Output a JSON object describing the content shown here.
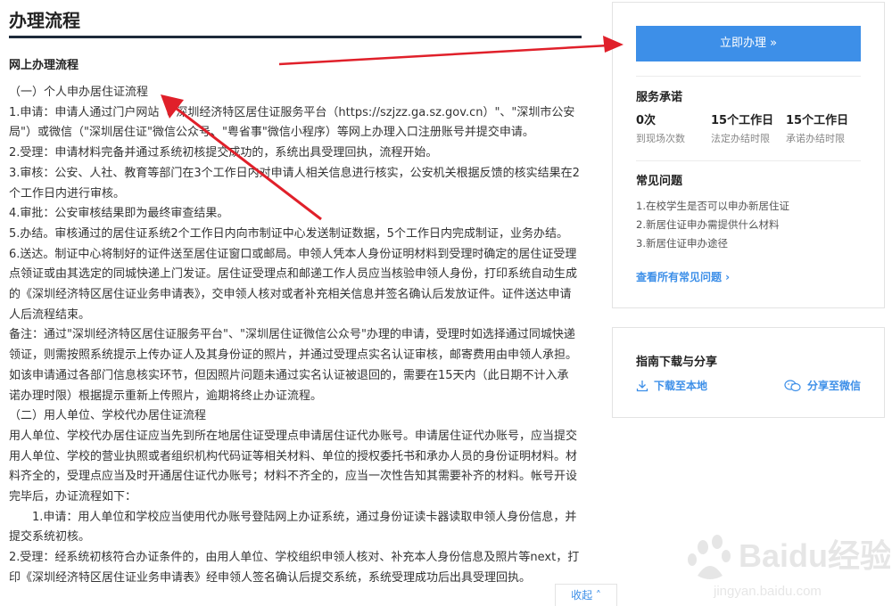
{
  "page": {
    "title": "办理流程",
    "section_title": "网上办理流程",
    "paragraphs": [
      "（一）个人申办居住证流程",
      "1.申请：申请人通过门户网站（\"深圳经济特区居住证服务平台（https://szjzz.ga.sz.gov.cn）\"、\"深圳市公安局\"）或微信（\"深圳居住证\"微信公众号、\"粤省事\"微信小程序）等网上办理入口注册账号并提交申请。",
      "2.受理：申请材料完备并通过系统初核提交成功的，系统出具受理回执，流程开始。",
      "3.审核：公安、人社、教育等部门在3个工作日内对申请人相关信息进行核实，公安机关根据反馈的核实结果在2个工作日内进行审核。",
      "4.审批：公安审核结果即为最终审查结果。",
      "5.办结。审核通过的居住证系统2个工作日内向市制证中心发送制证数据，5个工作日内完成制证，业务办结。",
      "6.送达。制证中心将制好的证件送至居住证窗口或邮局。申领人凭本人身份证明材料到受理时确定的居住证受理点领证或由其选定的同城快递上门发证。居住证受理点和邮递工作人员应当核验申领人身份，打印系统自动生成的《深圳经济特区居住证业务申请表》，交申领人核对或者补充相关信息并签名确认后发放证件。证件送达申请人后流程结束。",
      "备注：通过\"深圳经济特区居住证服务平台\"、\"深圳居住证微信公众号\"办理的申请，受理时如选择通过同城快递领证，则需按照系统提示上传办证人及其身份证的照片，并通过受理点实名认证审核，邮寄费用由申领人承担。如该申请通过各部门信息核实环节，但因照片问题未通过实名认证被退回的，需要在15天内（此日期不计入承诺办理时限）根据提示重新上传照片，逾期将终止办证流程。",
      "（二）用人单位、学校代办居住证流程",
      "用人单位、学校代办居住证应当先到所在地居住证受理点申请居住证代办账号。申请居住证代办账号，应当提交用人单位、学校的营业执照或者组织机构代码证等相关材料、单位的授权委托书和承办人员的身份证明材料。材料齐全的，受理点应当及时开通居住证代办账号；材料不齐全的，应当一次性告知其需要补齐的材料。帐号开设完毕后，办证流程如下：",
      "1.申请：用人单位和学校应当使用代办账号登陆网上办证系统，通过身份证读卡器读取申领人身份信息，并提交系统初核。",
      "2.受理：经系统初核符合办证条件的，由用人单位、学校组织申领人核对、补充本人身份信息及照片等next，打印《深圳经济特区居住证业务申请表》经申领人签名确认后提交系统，系统受理成功后出具受理回执。"
    ]
  },
  "sidebar": {
    "apply_button": "立即办理 »",
    "service_title": "服务承诺",
    "stats": [
      {
        "value": "0次",
        "label": "到现场次数"
      },
      {
        "value": "15个工作日",
        "label": "法定办结时限"
      },
      {
        "value": "15个工作日",
        "label": "承诺办结时限"
      }
    ],
    "faq_title": "常见问题",
    "faq_items": [
      "1.在校学生是否可以申办新居住证",
      "2.新居住证申办需提供什么材料",
      "3.新居住证申办途径"
    ],
    "faq_all": "查看所有常见问题 ›",
    "share_title": "指南下载与分享",
    "download_label": "下载至本地",
    "share_label": "分享至微信"
  },
  "collapse_label": "收起 ˄",
  "watermark": {
    "brand": "Baidu经验",
    "url": "jingyan.baidu.com"
  },
  "colors": {
    "accent": "#3d8fe8",
    "arrow": "#e0202a",
    "title_rule": "#1d2a3a"
  }
}
